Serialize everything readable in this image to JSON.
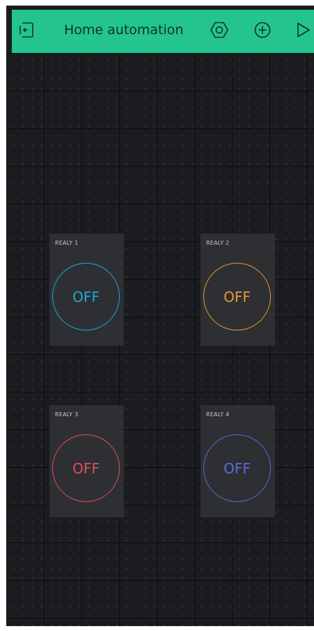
{
  "header": {
    "title": "Home automation",
    "background": "#23c48e",
    "icons": {
      "left": "exit-door-icon",
      "settings": "hexagon-settings-icon",
      "add": "add-widget-icon",
      "play": "play-icon"
    }
  },
  "widgets": [
    {
      "label": "REALY 1",
      "state": "OFF",
      "color": "#20a8d6"
    },
    {
      "label": "REALY 2",
      "state": "OFF",
      "color": "#e29a2e"
    },
    {
      "label": "REALY 3",
      "state": "OFF",
      "color": "#d9515e"
    },
    {
      "label": "REALY 4",
      "state": "OFF",
      "color": "#5a6bd8"
    }
  ]
}
